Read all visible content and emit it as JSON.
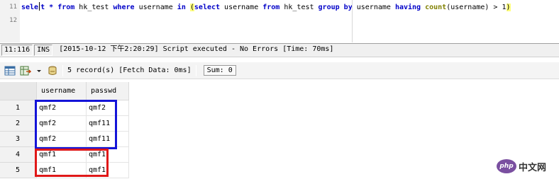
{
  "editor": {
    "line_numbers": [
      "11",
      "12"
    ],
    "sql": {
      "t1": "sele",
      "t2": "t * ",
      "kw_from": "from",
      "t3": " hk_test ",
      "kw_where": "where",
      "t4": " username ",
      "kw_in": "in",
      "t5": " ",
      "paren_open": "(",
      "kw_select": "select",
      "t6": " username ",
      "kw_from2": "from",
      "t7": " hk_test ",
      "kw_group": "group",
      "t8": " ",
      "kw_by": "by",
      "t9": " username ",
      "kw_having": "having",
      "t10": " ",
      "fn_count": "count",
      "t11": "(username) > 1",
      "paren_close": ")"
    }
  },
  "statusbar": {
    "position": "11:116",
    "mode": "INS",
    "message": "[2015-10-12 下午2:20:29] Script executed - No Errors [Time: 70ms]"
  },
  "result_toolbar": {
    "icons": [
      "grid-view-icon",
      "export-icon",
      "dropdown-arrow-icon",
      "filter-icon"
    ],
    "record_info": "5 record(s) [Fetch Data: 0ms]",
    "sum_label": "Sum: 0"
  },
  "grid": {
    "columns": [
      "username",
      "passwd"
    ],
    "rows": [
      {
        "num": "1",
        "username": "qmf2",
        "passwd": "qmf2"
      },
      {
        "num": "2",
        "username": "qmf2",
        "passwd": "qmf11"
      },
      {
        "num": "3",
        "username": "qmf2",
        "passwd": "qmf11"
      },
      {
        "num": "4",
        "username": "qmf1",
        "passwd": "qmf1"
      },
      {
        "num": "5",
        "username": "qmf1",
        "passwd": "qmf1"
      }
    ],
    "highlight_colors": {
      "group_qmf2": "#1414d8",
      "group_qmf1": "#e01818"
    }
  },
  "watermark": {
    "badge": "php",
    "text": "中文网"
  }
}
